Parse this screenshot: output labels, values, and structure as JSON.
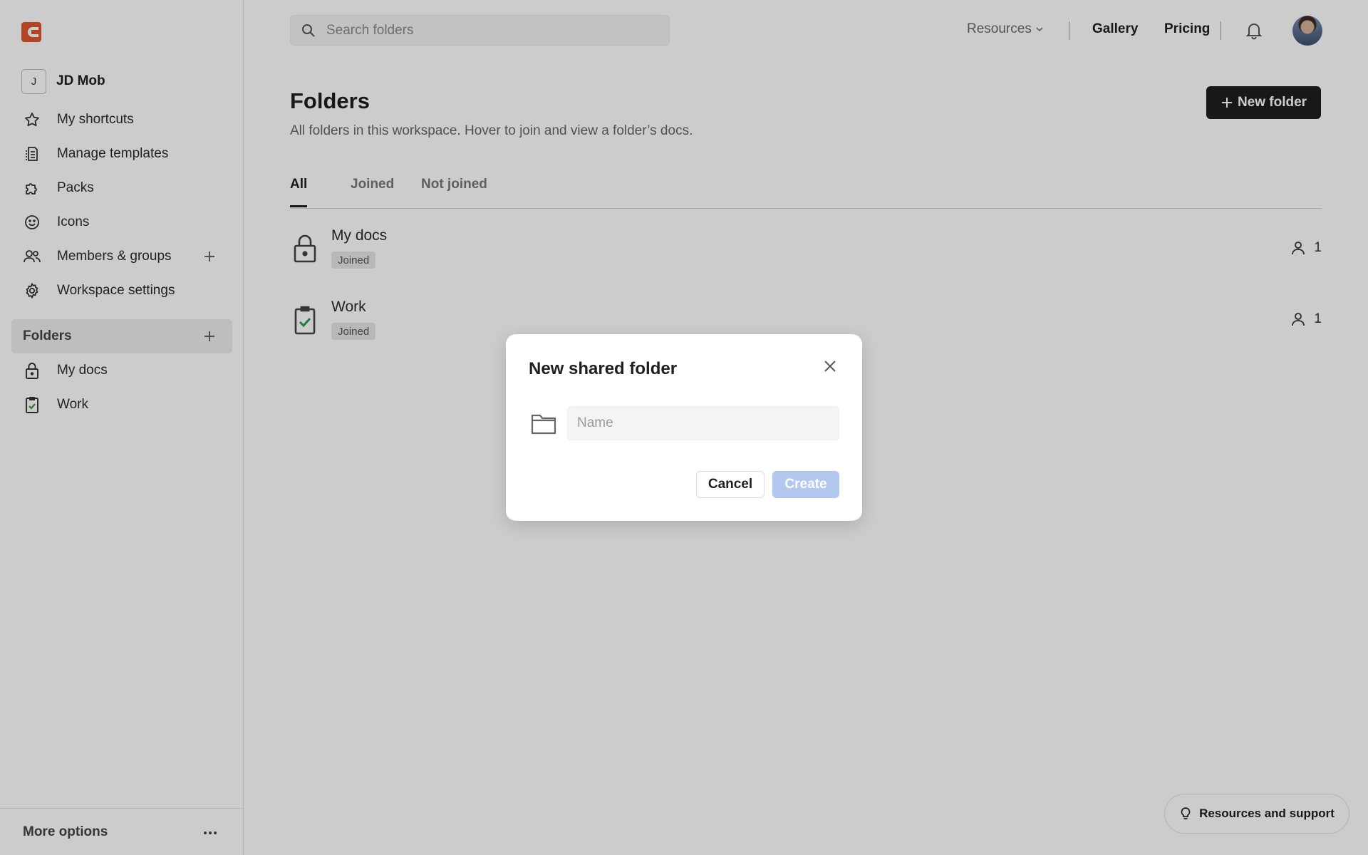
{
  "workspace": {
    "initial": "J",
    "name": "JD Mob"
  },
  "sidebar": {
    "items": [
      {
        "label": "My shortcuts",
        "icon": "star-icon"
      },
      {
        "label": "Manage templates",
        "icon": "templates-icon"
      },
      {
        "label": "Packs",
        "icon": "puzzle-icon"
      },
      {
        "label": "Icons",
        "icon": "smiley-icon"
      },
      {
        "label": "Members & groups",
        "icon": "members-icon"
      },
      {
        "label": "Workspace settings",
        "icon": "gear-icon"
      }
    ],
    "folders_header": "Folders",
    "folders": [
      {
        "label": "My docs",
        "icon": "lock-icon"
      },
      {
        "label": "Work",
        "icon": "clipboard-check-icon"
      }
    ],
    "more_options": "More options"
  },
  "search": {
    "placeholder": "Search folders"
  },
  "topnav": {
    "resources": "Resources",
    "gallery": "Gallery",
    "pricing": "Pricing"
  },
  "page": {
    "title": "Folders",
    "subtitle": "All folders in this workspace. Hover to join and view a folder’s docs.",
    "new_folder_label": "New folder"
  },
  "tabs": [
    {
      "label": "All",
      "active": true
    },
    {
      "label": "Joined",
      "active": false
    },
    {
      "label": "Not joined",
      "active": false
    }
  ],
  "folder_rows": [
    {
      "name": "My docs",
      "badge": "Joined",
      "members": "1",
      "icon": "lock-icon"
    },
    {
      "name": "Work",
      "badge": "Joined",
      "members": "1",
      "icon": "clipboard-check-icon"
    }
  ],
  "modal": {
    "title": "New shared folder",
    "name_placeholder": "Name",
    "name_value": "",
    "cancel_label": "Cancel",
    "create_label": "Create"
  },
  "support": {
    "label": "Resources and support"
  },
  "colors": {
    "accent_logo": "#e0562d",
    "primary_dark": "#1f1f1f",
    "create_disabled": "#b3c8ee",
    "check_green": "#2e9d4a",
    "overlay": "rgba(0,0,0,0.2)"
  }
}
